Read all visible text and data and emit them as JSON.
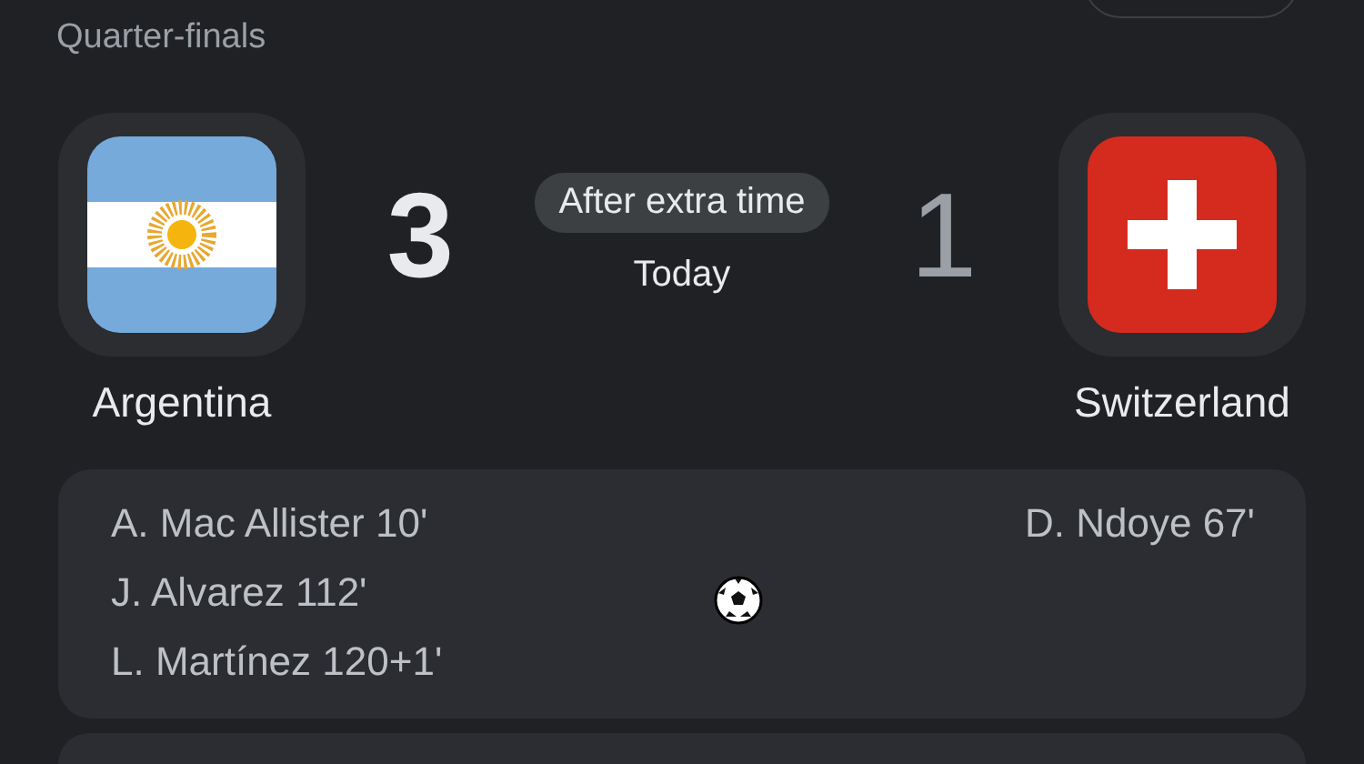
{
  "stage": "Quarter-finals",
  "teams": [
    {
      "name": "Argentina",
      "score": "3",
      "winner": true,
      "kind": "sun-stripes"
    },
    {
      "name": "Switzerland",
      "score": "1",
      "winner": false,
      "kind": "cross"
    }
  ],
  "status": "After extra time",
  "date": "Today",
  "goals": {
    "home": [
      "A. Mac Allister 10'",
      "J. Alvarez 112'",
      "L. Martínez 120+1'"
    ],
    "away": [
      "D. Ndoye 67'"
    ]
  }
}
